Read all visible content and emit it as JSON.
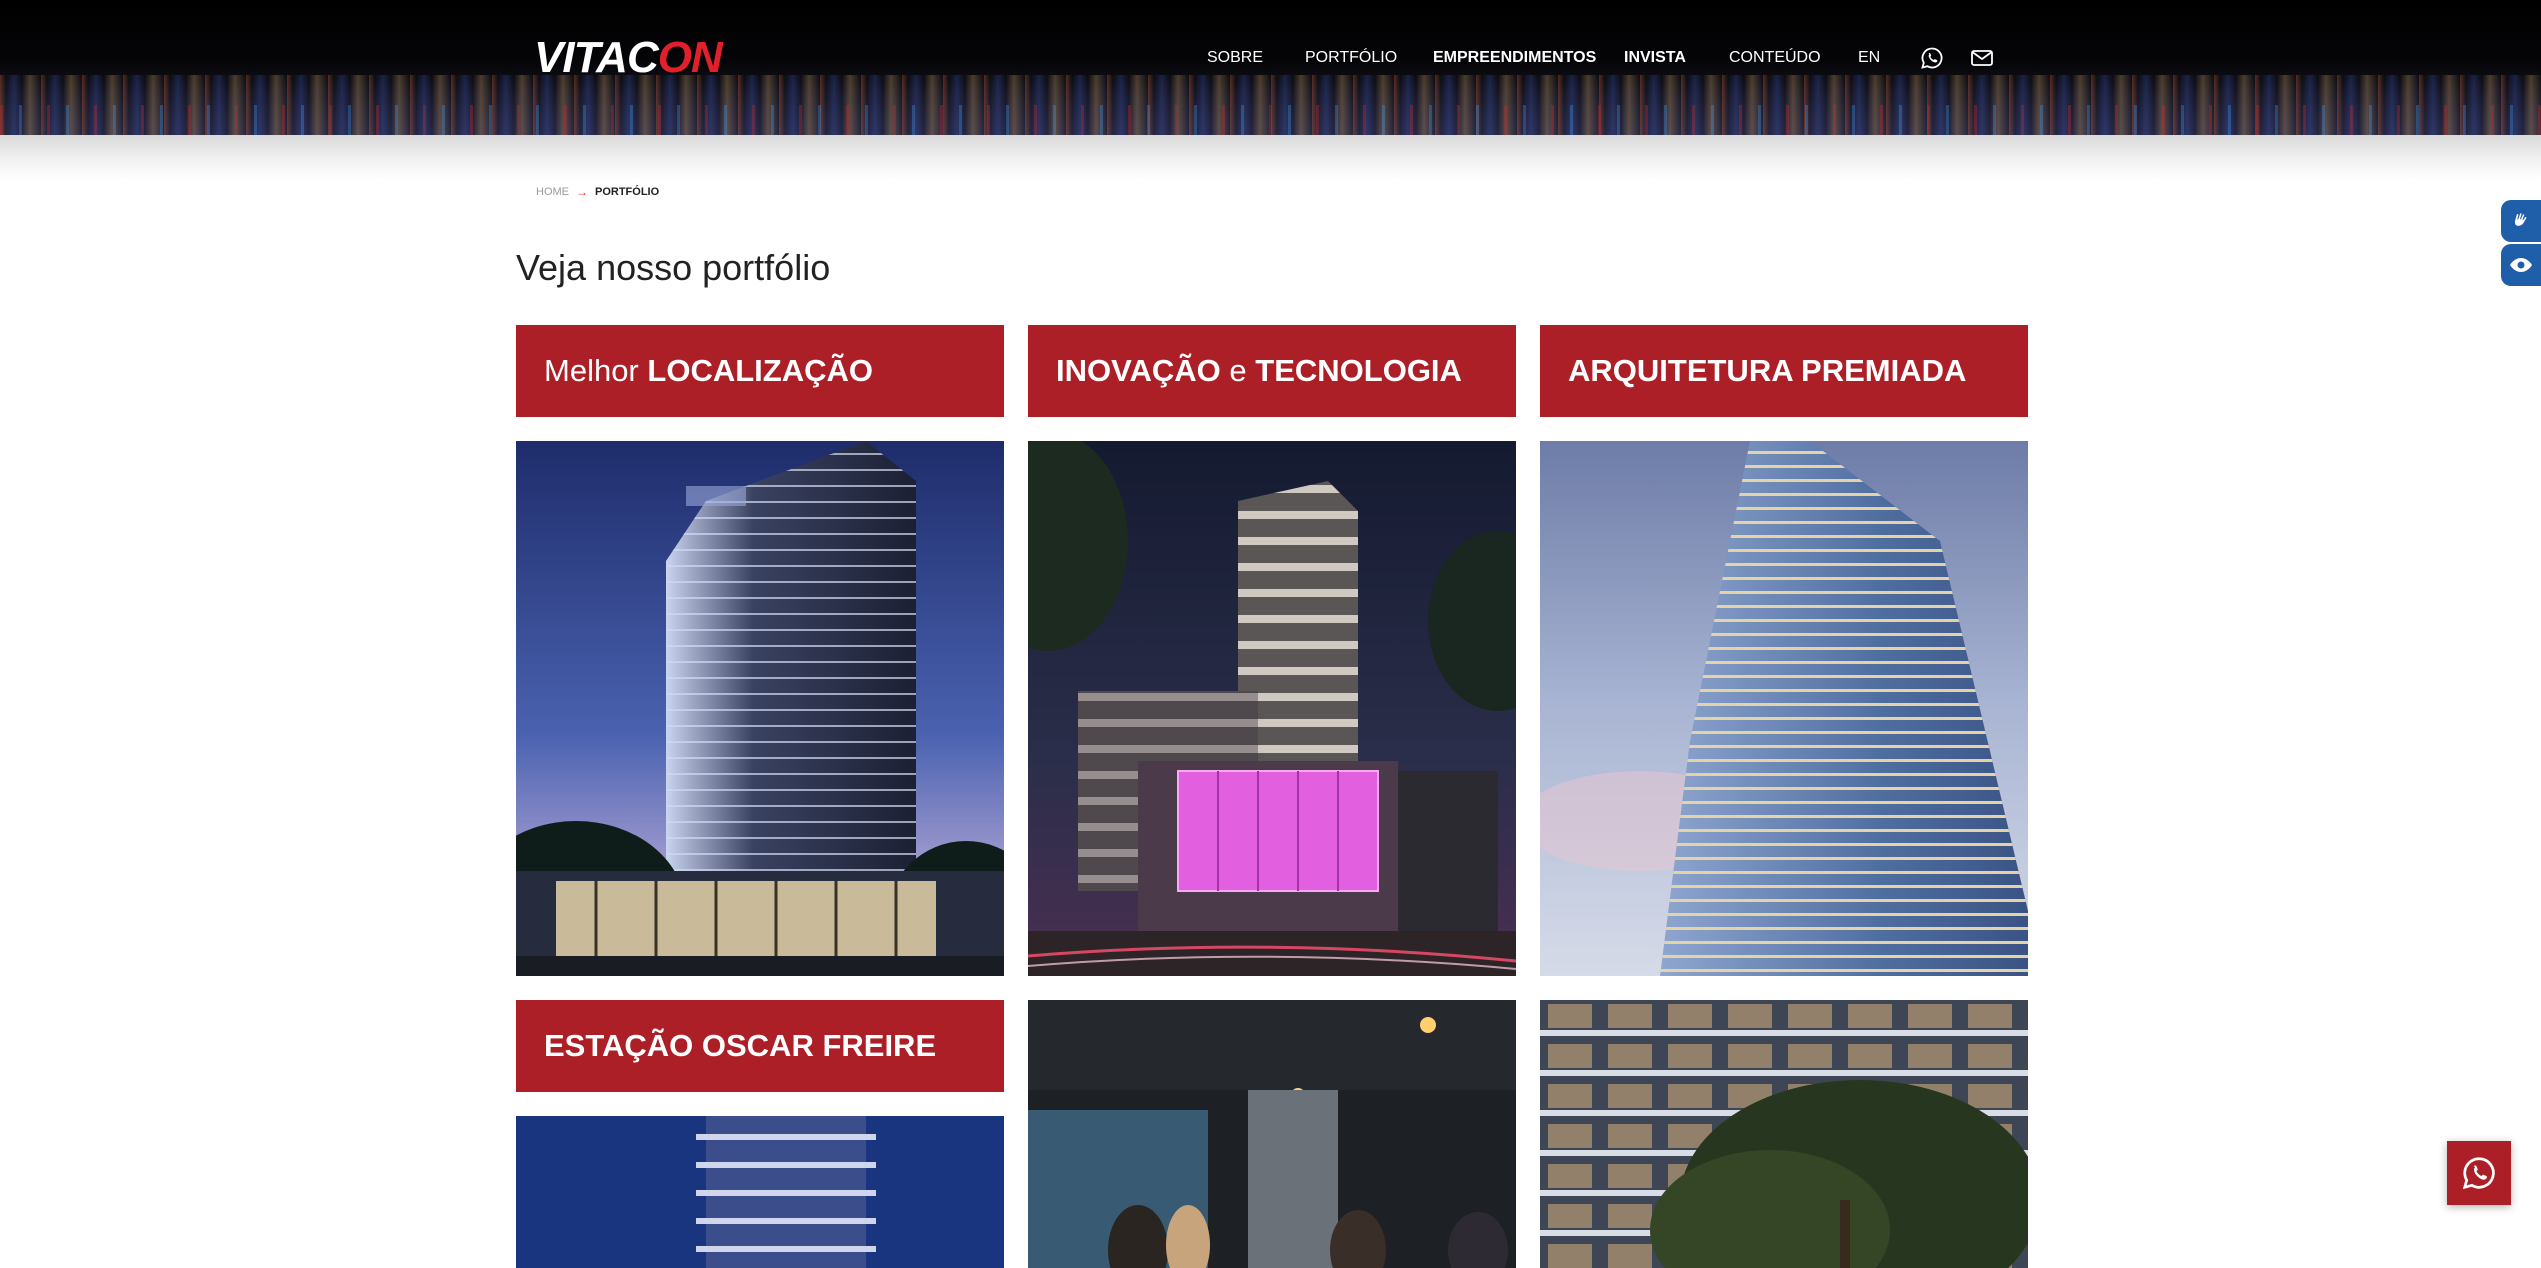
{
  "header": {
    "logo": {
      "part1": "VITAC",
      "part2": "ON"
    },
    "nav": [
      {
        "label": "SOBRE"
      },
      {
        "label": "PORTFÓLIO"
      },
      {
        "label": "EMPREENDIMENTOS"
      },
      {
        "label": "INVISTA"
      },
      {
        "label": "CONTEÚDO"
      },
      {
        "label": "EN"
      }
    ],
    "icons": [
      "whatsapp-icon",
      "mail-icon"
    ]
  },
  "breadcrumb": {
    "home": "HOME",
    "separator": "→",
    "current": "PORTFÓLIO"
  },
  "page": {
    "title": "Veja nosso portfólio"
  },
  "cards": [
    {
      "title_light": "Melhor ",
      "title_bold": "LOCALIZAÇÃO"
    },
    {
      "title_light": "e",
      "title_bold_a": "INOVAÇÃO",
      "title_bold_b": "TECNOLOGIA"
    },
    {
      "title_bold": "ARQUITETURA PREMIADA"
    },
    {
      "title_bold": "ESTAÇÃO OSCAR FREIRE"
    }
  ],
  "accessibility": {
    "buttons": [
      "sign-language-icon",
      "eye-icon"
    ]
  },
  "floating": {
    "button": "whatsapp-float-button"
  },
  "colors": {
    "brand_red": "#ad1f27",
    "logo_red": "#e2202b",
    "a11y_blue": "#1f5ea8"
  }
}
